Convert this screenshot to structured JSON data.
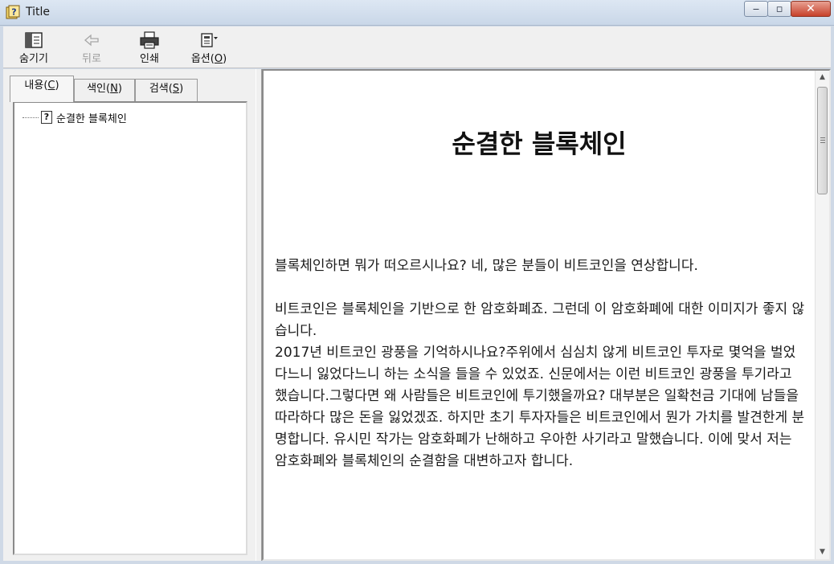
{
  "window": {
    "title": "Title",
    "minimize_glyph": "‒",
    "maximize_glyph": "▫",
    "close_glyph": "✕"
  },
  "toolbar": {
    "hide_label": "숨기기",
    "back_label": "뒤로",
    "print_label": "인쇄",
    "options_label_prefix": "옵션(",
    "options_label_key": "O",
    "options_label_suffix": ")"
  },
  "tabs": [
    {
      "label_prefix": "내용(",
      "key": "C",
      "label_suffix": ")"
    },
    {
      "label_prefix": "색인(",
      "key": "N",
      "label_suffix": ")"
    },
    {
      "label_prefix": "검색(",
      "key": "S",
      "label_suffix": ")"
    }
  ],
  "tree": {
    "items": [
      {
        "label": "순결한 블록체인",
        "icon_glyph": "?"
      }
    ]
  },
  "document": {
    "title": "순결한 블록체인",
    "paragraphs": [
      "블록체인하면 뭐가 떠오르시나요? 네, 많은 분들이 비트코인을 연상합니다.",
      "비트코인은 블록체인을 기반으로 한 암호화폐죠. 그런데 이 암호화폐에 대한 이미지가 좋지 않습니다.",
      "2017년 비트코인 광풍을 기억하시나요?주위에서 심심치 않게 비트코인 투자로 몇억을 벌었다느니 잃었다느니 하는 소식을 들을 수 있었죠. 신문에서는 이런 비트코인 광풍을 투기라고 했습니다.그렇다면 왜 사람들은 비트코인에 투기했을까요? 대부분은 일확천금 기대에 남들을 따라하다 많은 돈을 잃었겠죠. 하지만 초기 투자자들은 비트코인에서 뭔가 가치를 발견한게 분명합니다. 유시민 작가는 암호화폐가 난해하고 우아한 사기라고 말했습니다. 이에 맞서 저는 암호화폐와 블록체인의 순결함을 대변하고자 합니다."
    ]
  },
  "scrollbar": {
    "up_glyph": "▲",
    "down_glyph": "▼"
  },
  "colors": {
    "titlebar": "#c9d7e8",
    "close_button": "#c7412a",
    "chrome": "#f0f0f0"
  }
}
